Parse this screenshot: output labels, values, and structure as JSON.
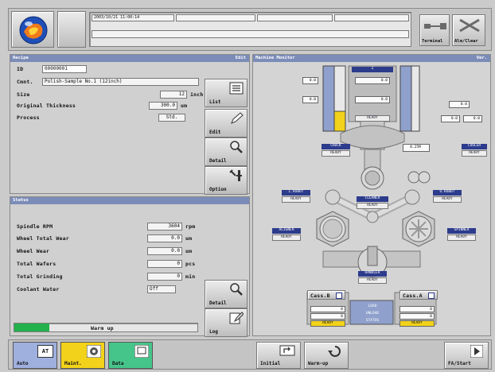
{
  "header": {
    "timestamp": "2003/10/21 11:00:14",
    "terminal_label": "Terminal",
    "alarm_clear_label": "Alm/Clear"
  },
  "recipe": {
    "title": "Recipe",
    "title_right": "Edit",
    "id_label": "ID",
    "id_value": "00000001",
    "comment_label": "Cmnt.",
    "comment_value": "Polish-Sample No.1 (12inch)",
    "size_label": "Size",
    "size_value": "12",
    "size_unit": "inch",
    "thickness_label": "Original Thickness",
    "thickness_value": "300.0",
    "thickness_unit": "um",
    "process_label": "Process",
    "process_value": "Std."
  },
  "recipe_buttons": {
    "list": "List",
    "edit": "Edit",
    "detail": "Detail",
    "option": "Option"
  },
  "status": {
    "title": "Status",
    "rows": [
      {
        "label": "Spindle RPM",
        "value": "3604",
        "unit": "rpm"
      },
      {
        "label": "Wheel Total Wear",
        "value": "0.0",
        "unit": "um"
      },
      {
        "label": "Wheel Wear",
        "value": "0.0",
        "unit": "um"
      },
      {
        "label": "Total Wafers",
        "value": "0",
        "unit": "pcs"
      },
      {
        "label": "Total Grinding",
        "value": "0",
        "unit": "min"
      },
      {
        "label": "Coolant Water",
        "value": "Off",
        "unit": ""
      }
    ],
    "progress_label": "Warm up",
    "progress_fraction": 0.19,
    "detail_button": "Detail",
    "log_button": "Log"
  },
  "monitor": {
    "title": "Machine Monitor",
    "title_right": "Ver.",
    "gauge_left_1": "0.0",
    "gauge_left_2": "0.0",
    "z_head_label": "Z",
    "z_box_1": "0.0",
    "z_box_2": "0.0",
    "z_ready": "READY",
    "right_box_1": "0.0",
    "right_box_2": "0.0",
    "right_box_3": "0.0",
    "chuck_label": "CHUCK",
    "chuck_ready": "READY",
    "mid_box": "0.25M",
    "right_tag": "COOLER",
    "right_ready": "READY",
    "tag_left_upper": "L.ROBOT",
    "tag_left_upper_state": "READY",
    "tag_center": "CLEANER",
    "tag_center_state": "READY",
    "tag_right_upper": "U.ROBOT",
    "tag_right_upper_state": "READY",
    "tag_left_lower": "ALIGNER",
    "tag_left_lower_state": "READY",
    "tag_right_lower": "SPINNER",
    "tag_right_lower_state": "READY",
    "tag_bottom": "HANDLER",
    "tag_bottom_state": "READY",
    "cass_b_label": "Cass.B",
    "cass_a_label": "Cass.A",
    "cass_b_val_1": "0",
    "cass_b_val_2": "0",
    "cass_b_status": "READY",
    "cass_a_val_1": "0",
    "cass_a_val_2": "0",
    "cass_a_status": "READY",
    "legend_1": "LOAD",
    "legend_2": "UNLOAD",
    "legend_3": "STATUS"
  },
  "footer": {
    "auto": "Auto",
    "maint": "Maint.",
    "data": "Data",
    "initial": "Initial",
    "warmup": "Warm-up",
    "fa_start": "FA/Start"
  },
  "colors": {
    "accent_blue": "#7b8cb8",
    "auto_tab": "#9fb0df",
    "maint_tab": "#f2d21a",
    "data_tab": "#46c58a",
    "progress": "#22b14c",
    "gauge_fill": "#f2d21a"
  }
}
